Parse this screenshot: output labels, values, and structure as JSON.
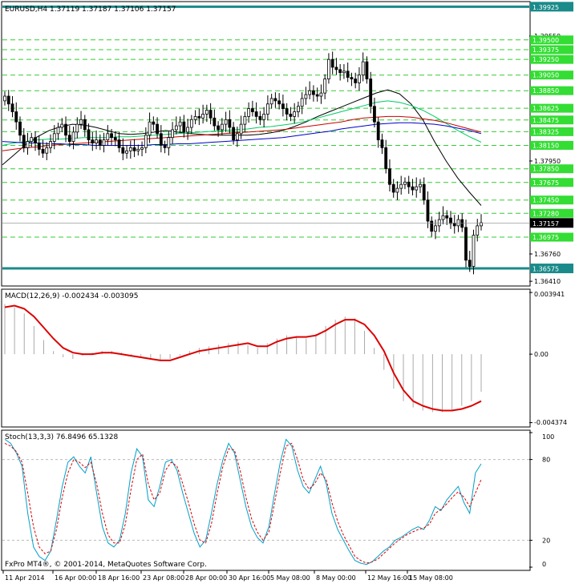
{
  "chart_data": [
    {
      "type": "line",
      "subtype": "candlestick",
      "title": "EURUSD,H4  1.37119 1.37187 1.37106 1.37157",
      "symbol": "EURUSD",
      "timeframe": "H4",
      "ohlc_last": {
        "open": 1.37119,
        "high": 1.37187,
        "low": 1.37106,
        "close": 1.37157
      },
      "current_price": "1.37157",
      "ylim": [
        1.3636,
        1.3998
      ],
      "levels": [
        {
          "label": "1.39925",
          "value": 1.39925,
          "style": "thick"
        },
        {
          "label": "1.39550",
          "value": 1.3955,
          "style": "tick"
        },
        {
          "label": "1.39500",
          "value": 1.395,
          "style": "dashed"
        },
        {
          "label": "1.39375",
          "value": 1.39375,
          "style": "dashed"
        },
        {
          "label": "1.39250",
          "value": 1.3925,
          "style": "dashed"
        },
        {
          "label": "1.39050",
          "value": 1.3905,
          "style": "dashed"
        },
        {
          "label": "1.38850",
          "value": 1.3885,
          "style": "dashed"
        },
        {
          "label": "1.38625",
          "value": 1.38625,
          "style": "dashed"
        },
        {
          "label": "1.38475",
          "value": 1.38475,
          "style": "dashed"
        },
        {
          "label": "1.38325",
          "value": 1.38325,
          "style": "dashed"
        },
        {
          "label": "1.38150",
          "value": 1.3815,
          "style": "dashed"
        },
        {
          "label": "1.37950",
          "value": 1.3795,
          "style": "tick"
        },
        {
          "label": "1.37850",
          "value": 1.3785,
          "style": "dashed"
        },
        {
          "label": "1.37675",
          "value": 1.37675,
          "style": "dashed"
        },
        {
          "label": "1.37450",
          "value": 1.3745,
          "style": "dashed"
        },
        {
          "label": "1.37280",
          "value": 1.3728,
          "style": "dashed"
        },
        {
          "label": "1.36975",
          "value": 1.36975,
          "style": "dashed"
        },
        {
          "label": "1.36760",
          "value": 1.3676,
          "style": "tick"
        },
        {
          "label": "1.36575",
          "value": 1.36575,
          "style": "thick"
        },
        {
          "label": "1.36410",
          "value": 1.3641,
          "style": "tick"
        }
      ],
      "candles_close": [
        1.3878,
        1.3868,
        1.3858,
        1.3845,
        1.3828,
        1.3812,
        1.382,
        1.3825,
        1.3818,
        1.381,
        1.3805,
        1.3812,
        1.382,
        1.383,
        1.3838,
        1.3842,
        1.3828,
        1.382,
        1.3832,
        1.3842,
        1.3848,
        1.3835,
        1.3822,
        1.3818,
        1.3822,
        1.3815,
        1.3822,
        1.383,
        1.3825,
        1.3822,
        1.3812,
        1.3805,
        1.3808,
        1.3812,
        1.3808,
        1.381,
        1.3812,
        1.3828,
        1.3845,
        1.3842,
        1.383,
        1.3815,
        1.3812,
        1.3825,
        1.3835,
        1.384,
        1.3845,
        1.3832,
        1.3838,
        1.3848,
        1.3852,
        1.385,
        1.3855,
        1.386,
        1.385,
        1.384,
        1.3835,
        1.3842,
        1.3848,
        1.3838,
        1.3822,
        1.383,
        1.3842,
        1.3852,
        1.3862,
        1.3858,
        1.3852,
        1.3848,
        1.3855,
        1.3868,
        1.3875,
        1.3872,
        1.3868,
        1.3862,
        1.3855,
        1.3852,
        1.3858,
        1.3865,
        1.3875,
        1.388,
        1.3885,
        1.388,
        1.3878,
        1.3882,
        1.39,
        1.3925,
        1.3915,
        1.3912,
        1.3908,
        1.391,
        1.3902,
        1.39,
        1.3895,
        1.3905,
        1.3922,
        1.39,
        1.3865,
        1.3845,
        1.3822,
        1.3812,
        1.3785,
        1.3765,
        1.3755,
        1.376,
        1.3765,
        1.3768,
        1.3762,
        1.3758,
        1.3762,
        1.3765,
        1.3745,
        1.3718,
        1.3705,
        1.3712,
        1.372,
        1.3725,
        1.3722,
        1.3715,
        1.3712,
        1.372,
        1.371,
        1.3668,
        1.366,
        1.37,
        1.3712,
        1.3716
      ],
      "moving_averages": [
        {
          "color": "#000000",
          "values": [
            1.379,
            1.3803,
            1.3816,
            1.3826,
            1.3834,
            1.3839,
            1.3842,
            1.3841,
            1.3838,
            1.3834,
            1.383,
            1.3829,
            1.383,
            1.3832,
            1.3834,
            1.3832,
            1.383,
            1.3829,
            1.3828,
            1.3828,
            1.3828,
            1.3828,
            1.3829,
            1.3831,
            1.3834,
            1.3839,
            1.3845,
            1.3852,
            1.3858,
            1.3864,
            1.387,
            1.3876,
            1.3882,
            1.3886,
            1.3881,
            1.3868,
            1.3848,
            1.382,
            1.3795,
            1.3773,
            1.3755,
            1.3738
          ]
        },
        {
          "color": "#00cc66",
          "values": [
            1.3815,
            1.3818,
            1.382,
            1.3822,
            1.3823,
            1.3823,
            1.3824,
            1.3825,
            1.3825,
            1.3825,
            1.3826,
            1.3826,
            1.3827,
            1.3828,
            1.3829,
            1.383,
            1.3831,
            1.3832,
            1.3833,
            1.3834,
            1.3835,
            1.3836,
            1.3838,
            1.3839,
            1.3841,
            1.3843,
            1.3846,
            1.385,
            1.3854,
            1.3858,
            1.3862,
            1.3866,
            1.387,
            1.3872,
            1.387,
            1.3866,
            1.386,
            1.3852,
            1.3843,
            1.3834,
            1.3826,
            1.3819
          ]
        },
        {
          "color": "#cc0000",
          "values": [
            1.3808,
            1.381,
            1.3812,
            1.3813,
            1.3815,
            1.3816,
            1.3817,
            1.3818,
            1.3819,
            1.382,
            1.3821,
            1.3822,
            1.3823,
            1.3824,
            1.3825,
            1.3826,
            1.3827,
            1.3828,
            1.3829,
            1.383,
            1.3831,
            1.3832,
            1.3833,
            1.3834,
            1.3835,
            1.3837,
            1.3839,
            1.3841,
            1.3843,
            1.3845,
            1.3848,
            1.385,
            1.3851,
            1.3852,
            1.3852,
            1.3851,
            1.3849,
            1.3847,
            1.3844,
            1.384,
            1.3836,
            1.3832
          ]
        },
        {
          "color": "#0000cc",
          "values": [
            1.382,
            1.3819,
            1.3818,
            1.3818,
            1.3817,
            1.3817,
            1.3816,
            1.3816,
            1.3815,
            1.3815,
            1.3815,
            1.3815,
            1.3815,
            1.3816,
            1.3816,
            1.3817,
            1.3817,
            1.3818,
            1.3819,
            1.382,
            1.3821,
            1.3822,
            1.3823,
            1.3824,
            1.3825,
            1.3827,
            1.3829,
            1.3831,
            1.3833,
            1.3836,
            1.3838,
            1.384,
            1.3842,
            1.3843,
            1.3844,
            1.3844,
            1.3843,
            1.3842,
            1.384,
            1.3837,
            1.3834,
            1.383
          ]
        }
      ]
    },
    {
      "type": "line",
      "title": "MACD(12,26,9) -0.002434 -0.003095",
      "ylim": [
        -0.0046,
        0.0041
      ],
      "tick_labels": [
        "0.003941",
        "0.00",
        "-0.004374"
      ],
      "histogram_color": "#aaaaaa",
      "histogram": [
        0.0032,
        0.003,
        0.0026,
        0.0018,
        0.0009,
        0.0002,
        -0.0002,
        -0.0003,
        -0.0001,
        0.0001,
        0.0002,
        0.0002,
        0.0001,
        -0.0001,
        -0.0002,
        -0.0003,
        -0.0004,
        -0.0003,
        -0.0001,
        0.0002,
        0.0004,
        0.0005,
        0.0006,
        0.0007,
        0.0008,
        0.0006,
        0.0004,
        0.0007,
        0.001,
        0.0012,
        0.0011,
        0.001,
        0.0013,
        0.0018,
        0.0022,
        0.0024,
        0.0023,
        0.0015,
        0.0004,
        -0.001,
        -0.0022,
        -0.003,
        -0.0034,
        -0.0036,
        -0.0037,
        -0.0037,
        -0.0036,
        -0.0033,
        -0.003,
        -0.0024
      ],
      "signal_color": "#dd0000",
      "signal": [
        0.003,
        0.0031,
        0.0029,
        0.0024,
        0.0017,
        0.001,
        0.0004,
        0.0001,
        0.0,
        0.0,
        0.0001,
        0.0001,
        0.0,
        -0.0001,
        -0.0002,
        -0.0003,
        -0.0004,
        -0.0004,
        -0.0002,
        0.0,
        0.0002,
        0.0003,
        0.0004,
        0.0005,
        0.0006,
        0.0007,
        0.0005,
        0.0005,
        0.0008,
        0.001,
        0.0011,
        0.0011,
        0.0012,
        0.0015,
        0.0019,
        0.0022,
        0.0022,
        0.0019,
        0.0012,
        0.0002,
        -0.0012,
        -0.0023,
        -0.003,
        -0.0033,
        -0.0035,
        -0.0036,
        -0.0036,
        -0.0035,
        -0.0033,
        -0.003
      ]
    },
    {
      "type": "line",
      "title": "Stoch(13,3,3) 76.8496 65.1328",
      "ylim": [
        0,
        100
      ],
      "tick_labels": [
        "100",
        "80",
        "20",
        "0"
      ],
      "main_color": "#00a0c8",
      "signal_color": "#dd0000",
      "main": [
        95,
        92,
        85,
        75,
        40,
        15,
        8,
        5,
        12,
        35,
        60,
        78,
        82,
        75,
        70,
        82,
        55,
        30,
        18,
        15,
        20,
        40,
        70,
        88,
        82,
        50,
        45,
        60,
        78,
        80,
        72,
        55,
        40,
        25,
        15,
        20,
        40,
        62,
        80,
        92,
        85,
        65,
        45,
        30,
        22,
        18,
        30,
        55,
        78,
        95,
        90,
        72,
        60,
        55,
        65,
        75,
        62,
        40,
        28,
        20,
        12,
        5,
        3,
        2,
        4,
        8,
        12,
        15,
        20,
        22,
        25,
        28,
        30,
        28,
        35,
        45,
        42,
        50,
        55,
        60,
        48,
        40,
        70,
        76.8
      ],
      "signal": [
        92,
        90,
        86,
        78,
        55,
        30,
        15,
        10,
        12,
        28,
        52,
        70,
        80,
        78,
        74,
        78,
        62,
        40,
        24,
        18,
        18,
        32,
        58,
        80,
        84,
        62,
        50,
        55,
        72,
        78,
        75,
        62,
        48,
        32,
        20,
        18,
        32,
        55,
        75,
        88,
        87,
        72,
        52,
        36,
        26,
        20,
        26,
        48,
        70,
        90,
        92,
        80,
        65,
        58,
        62,
        70,
        65,
        48,
        34,
        24,
        16,
        8,
        5,
        3,
        4,
        6,
        10,
        14,
        18,
        21,
        24,
        26,
        28,
        29,
        32,
        40,
        43,
        47,
        52,
        56,
        52,
        45,
        55,
        65.1
      ]
    }
  ],
  "x_axis": {
    "labels": [
      "11 Apr 2014",
      "16 Apr 00:00",
      "18 Apr 16:00",
      "23 Apr 08:00",
      "28 Apr 00:00",
      "30 Apr 16:00",
      "5 May 08:00",
      "8 May 00:00",
      "12 May 16:00",
      "15 May 08:00"
    ]
  },
  "watermark": "FxPro MT4®, © 2001-2014, MetaQuotes Software Corp."
}
